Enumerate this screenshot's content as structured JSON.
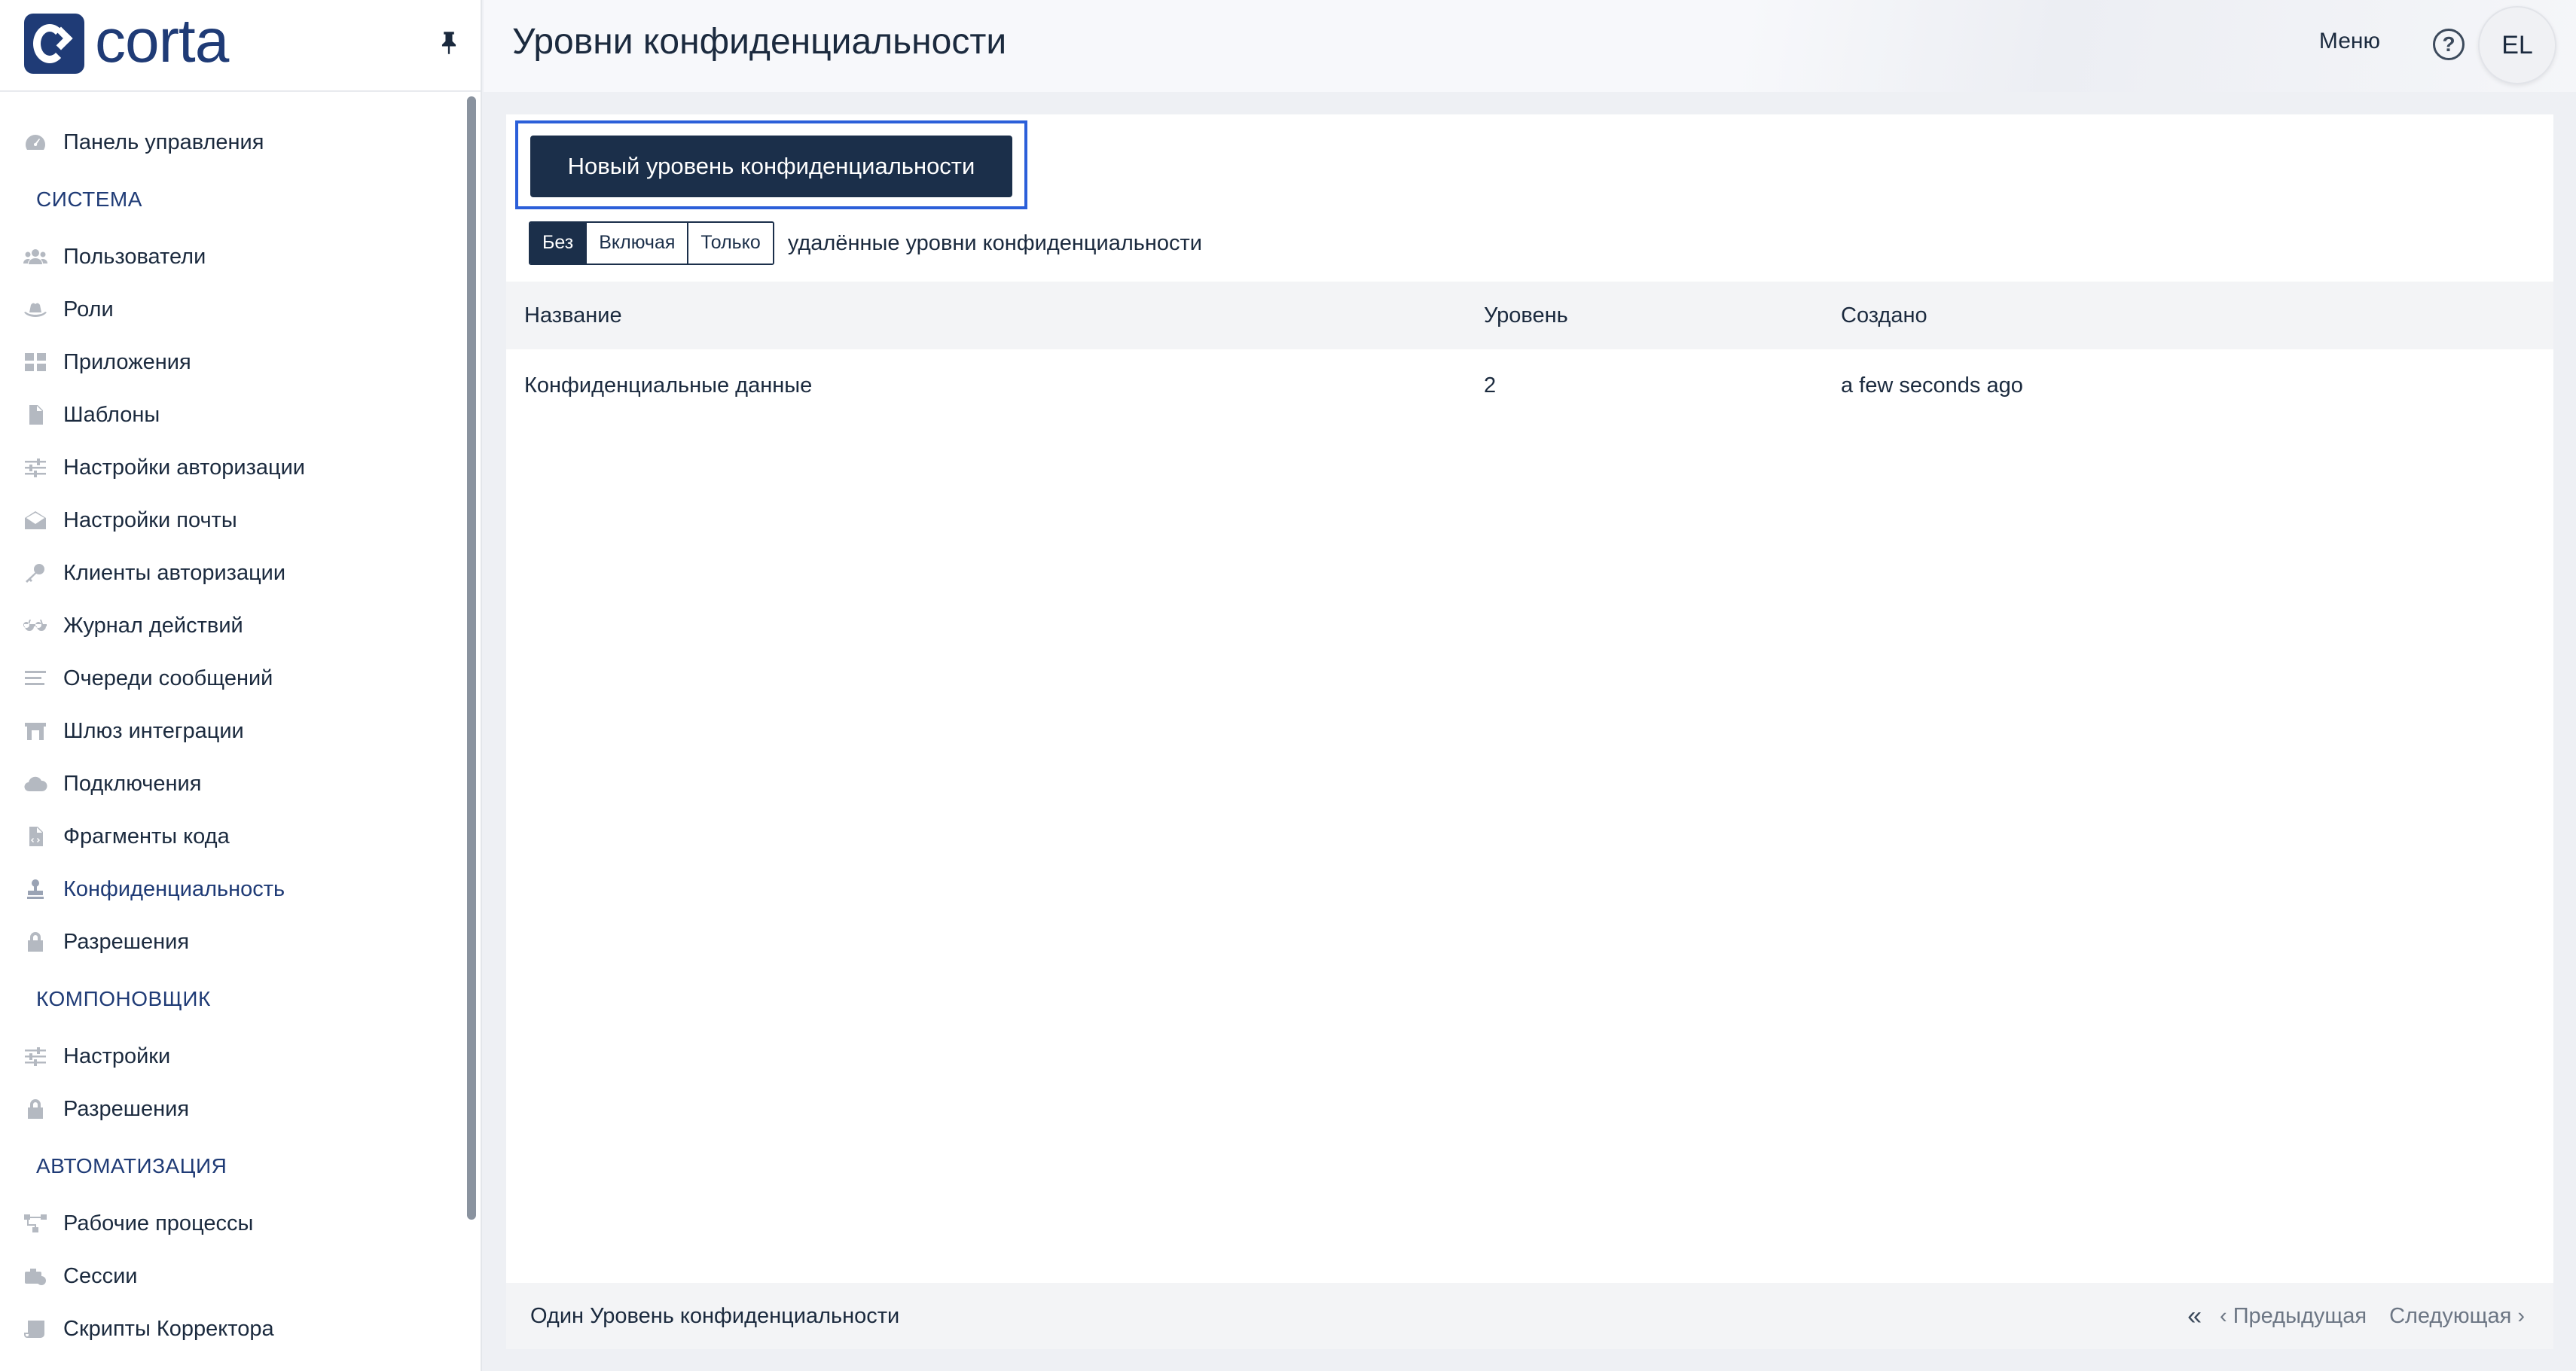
{
  "app": {
    "logo_text": "corta"
  },
  "header": {
    "title": "Уровни конфиденциальности",
    "menu_label": "Меню",
    "help_label": "?",
    "avatar_initials": "EL"
  },
  "sidebar": {
    "dashboard": {
      "label": "Панель управления",
      "icon": "gauge-icon"
    },
    "sections": [
      {
        "title": "СИСТЕМА"
      },
      {
        "title": "КОМПОНОВЩИК"
      },
      {
        "title": "АВТОМАТИЗАЦИЯ"
      }
    ],
    "system_items": [
      {
        "label": "Пользователи",
        "icon": "users-icon"
      },
      {
        "label": "Роли",
        "icon": "hat-icon"
      },
      {
        "label": "Приложения",
        "icon": "grid-icon"
      },
      {
        "label": "Шаблоны",
        "icon": "file-icon"
      },
      {
        "label": "Настройки авторизации",
        "icon": "sliders-icon"
      },
      {
        "label": "Настройки почты",
        "icon": "envelope-icon"
      },
      {
        "label": "Клиенты авторизации",
        "icon": "key-icon"
      },
      {
        "label": "Журнал действий",
        "icon": "glasses-icon"
      },
      {
        "label": "Очереди сообщений",
        "icon": "list-icon"
      },
      {
        "label": "Шлюз интеграции",
        "icon": "gateway-icon"
      },
      {
        "label": "Подключения",
        "icon": "cloud-icon"
      },
      {
        "label": "Фрагменты кода",
        "icon": "code-file-icon"
      },
      {
        "label": "Конфиденциальность",
        "icon": "stamp-icon"
      },
      {
        "label": "Разрешения",
        "icon": "lock-icon"
      }
    ],
    "composer_items": [
      {
        "label": "Настройки",
        "icon": "sliders-icon"
      },
      {
        "label": "Разрешения",
        "icon": "lock-icon"
      }
    ],
    "automation_items": [
      {
        "label": "Рабочие процессы",
        "icon": "workflow-icon"
      },
      {
        "label": "Сессии",
        "icon": "sessions-icon"
      },
      {
        "label": "Скрипты Корректора",
        "icon": "scroll-icon"
      }
    ]
  },
  "main": {
    "new_button_label": "Новый уровень конфиденциальности",
    "filter": {
      "options": [
        "Без",
        "Включая",
        "Только"
      ],
      "selected": "Без",
      "label": "удалённые уровни конфиденциальности"
    },
    "table": {
      "columns": [
        "Название",
        "Уровень",
        "Создано"
      ],
      "rows": [
        {
          "name": "Конфиденциальные данные",
          "level": "2",
          "created": "a few seconds ago"
        }
      ]
    },
    "footer": {
      "count_text": "Один Уровень конфиденциальности",
      "first_label": "«",
      "prev_label": "‹ Предыдущая",
      "next_label": "Следующая ›"
    }
  },
  "colors": {
    "brand": "#1f3b76",
    "primary_button": "#1b2f4a",
    "focus_outline": "#2b5fd9"
  }
}
